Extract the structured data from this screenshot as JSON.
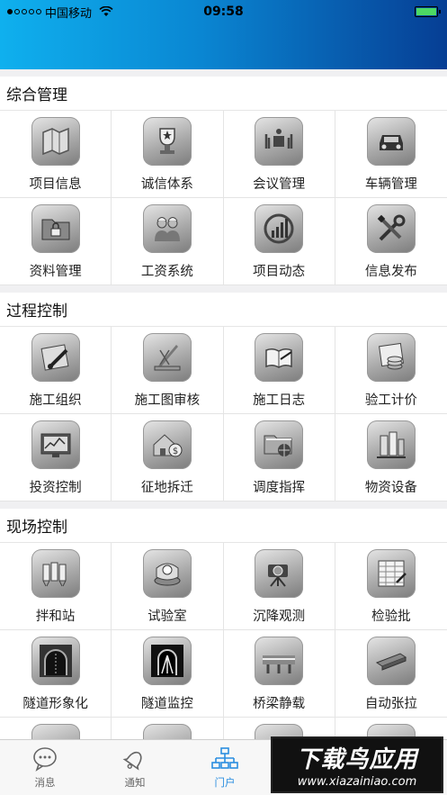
{
  "status": {
    "carrier": "中国移动",
    "time": "09:58",
    "battery_level": 1.0
  },
  "sections": [
    {
      "title": "综合管理",
      "items": [
        {
          "label": "项目信息",
          "icon": "map-scroll-icon"
        },
        {
          "label": "诚信体系",
          "icon": "trophy-icon"
        },
        {
          "label": "会议管理",
          "icon": "meeting-icon"
        },
        {
          "label": "车辆管理",
          "icon": "car-icon"
        },
        {
          "label": "资料管理",
          "icon": "locked-folder-icon"
        },
        {
          "label": "工资系统",
          "icon": "workers-icon"
        },
        {
          "label": "项目动态",
          "icon": "bar-chart-icon"
        },
        {
          "label": "信息发布",
          "icon": "tools-icon"
        }
      ]
    },
    {
      "title": "过程控制",
      "items": [
        {
          "label": "施工组织",
          "icon": "blueprint-pen-icon"
        },
        {
          "label": "施工图审核",
          "icon": "drafting-tools-icon"
        },
        {
          "label": "施工日志",
          "icon": "open-book-icon"
        },
        {
          "label": "验工计价",
          "icon": "calculator-coins-icon"
        },
        {
          "label": "投资控制",
          "icon": "monitor-chart-icon"
        },
        {
          "label": "征地拆迁",
          "icon": "house-dollar-icon"
        },
        {
          "label": "调度指挥",
          "icon": "folder-globe-icon"
        },
        {
          "label": "物资设备",
          "icon": "buildings-icon"
        }
      ]
    },
    {
      "title": "现场控制",
      "items": [
        {
          "label": "拌和站",
          "icon": "silos-icon"
        },
        {
          "label": "试验室",
          "icon": "lab-gauge-icon"
        },
        {
          "label": "沉降观测",
          "icon": "camera-survey-icon"
        },
        {
          "label": "检验批",
          "icon": "spreadsheet-icon"
        },
        {
          "label": "隧道形象化",
          "icon": "tunnel-icon"
        },
        {
          "label": "隧道监控",
          "icon": "tunnel-monitor-icon"
        },
        {
          "label": "桥梁静载",
          "icon": "bridge-icon"
        },
        {
          "label": "自动张拉",
          "icon": "beam-icon"
        }
      ]
    }
  ],
  "tabbar": [
    {
      "label": "消息",
      "icon": "chat-bubble-icon",
      "active": false
    },
    {
      "label": "通知",
      "icon": "bell-icon",
      "active": false
    },
    {
      "label": "门户",
      "icon": "org-chart-icon",
      "active": true
    }
  ],
  "watermark": {
    "title": "下载鸟应用",
    "url": "www.xiazainiao.com"
  }
}
